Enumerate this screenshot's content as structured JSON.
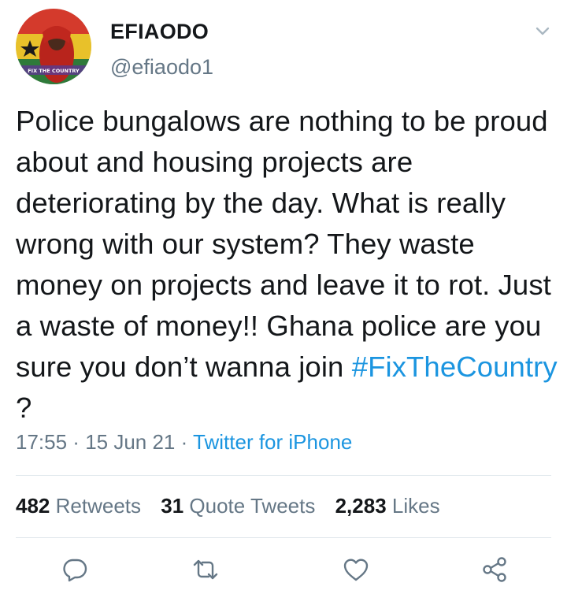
{
  "user": {
    "display_name": "EFIAODO",
    "handle": "@efiaodo1",
    "avatar_caption": "FIX THE COUNTRY"
  },
  "tweet": {
    "text_before": "Police bungalows are nothing to be proud about and  housing projects are deteriorating by the day. What is really wrong with our system? They waste money on projects and leave it to rot. Just a waste of money!! Ghana police are you sure you don’t wanna join ",
    "hashtag": "#FixTheCountry",
    "text_after": " ?",
    "time": "17:55",
    "date": "15 Jun 21",
    "separator": " · ",
    "source": "Twitter for iPhone"
  },
  "stats": {
    "retweets_count": "482",
    "retweets_label": "Retweets",
    "quotes_count": "31",
    "quotes_label": "Quote Tweets",
    "likes_count": "2,283",
    "likes_label": "Likes"
  },
  "actions": {
    "reply_icon": "reply-icon",
    "retweet_icon": "retweet-icon",
    "like_icon": "heart-icon",
    "share_icon": "share-icon",
    "more_icon": "chevron-down-icon"
  },
  "colors": {
    "link": "#1b95e0",
    "secondary_text": "#657786",
    "primary_text": "#14171a",
    "divider": "#e1e8ed"
  }
}
